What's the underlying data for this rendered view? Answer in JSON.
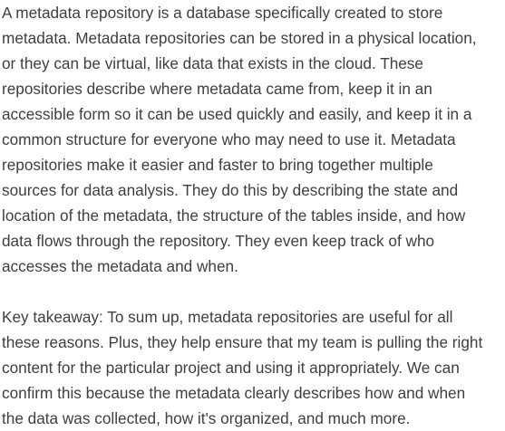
{
  "paragraphs": [
    {
      "lines": [
        "A metadata repository is a database specifically created to store",
        "metadata. Metadata repositories can be stored in a physical location,",
        "or they can be virtual, like data that exists in the cloud. These",
        "repositories describe where metadata came from, keep it in an",
        "accessible form so it can be used quickly and easily, and keep it in a",
        "common structure for everyone who may need to use it. Metadata",
        "repositories make it easier and faster to bring together multiple",
        "sources for data analysis. They do this by describing the state and",
        "location of the metadata, the structure of the tables inside, and how",
        "data flows through the repository. They even keep track of who",
        "accesses the metadata and when."
      ]
    },
    {
      "lines": [
        "Key takeaway: To sum up, metadata repositories are useful for all",
        "these reasons. Plus, they help ensure that my team is pulling the right",
        "content for the particular project and using it appropriately. We can",
        "confirm this because the metadata clearly describes how and when",
        "the data was collected, how it's organized, and much more."
      ]
    }
  ]
}
